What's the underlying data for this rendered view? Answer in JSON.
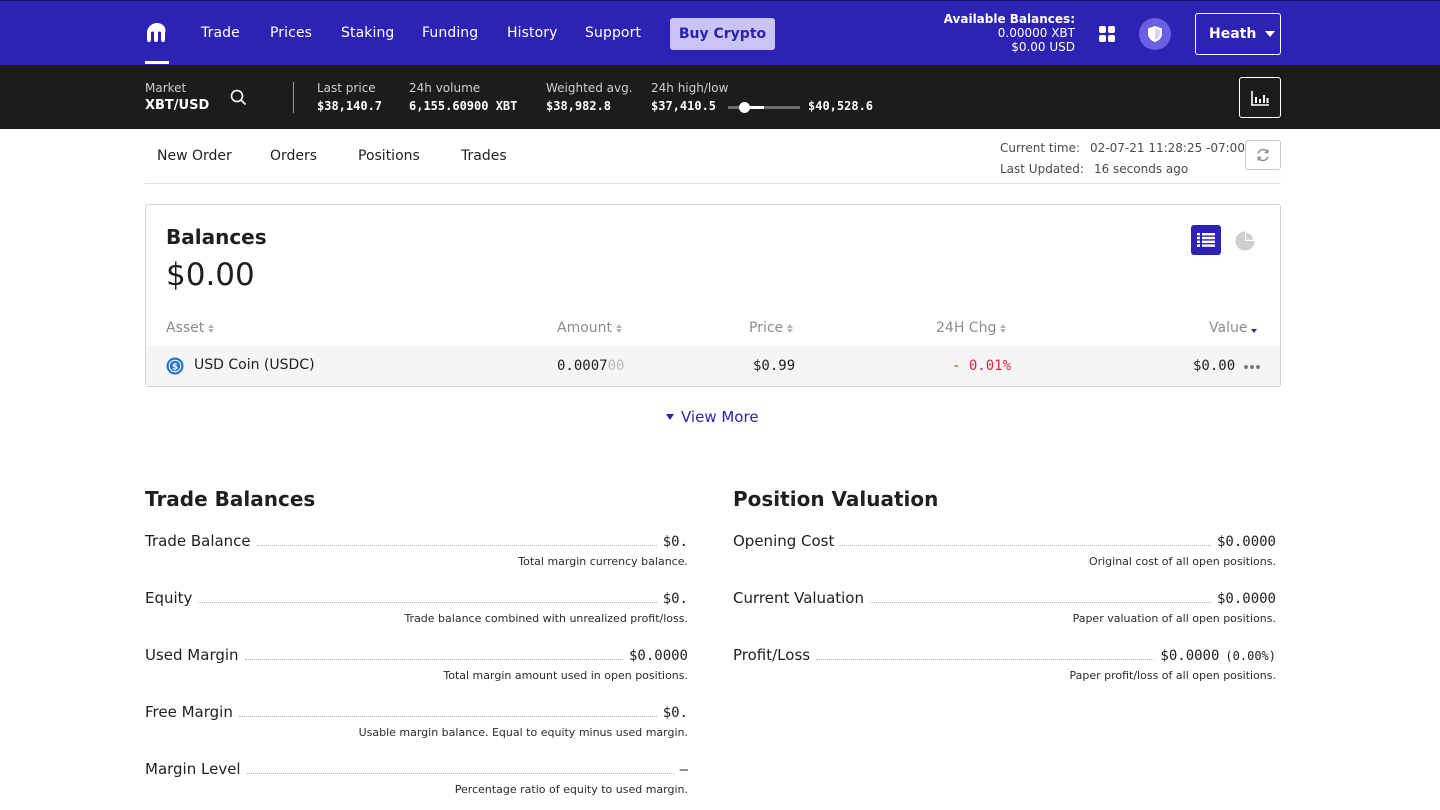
{
  "nav": {
    "items": [
      "Trade",
      "Prices",
      "Staking",
      "Funding",
      "History",
      "Support"
    ],
    "buy_label": "Buy Crypto",
    "balances_title": "Available Balances:",
    "balance_xbt": "0.00000 XBT",
    "balance_usd": "$0.00 USD",
    "user_name": "Heath"
  },
  "ticker": {
    "market_label": "Market",
    "pair": "XBT/USD",
    "last_price_label": "Last price",
    "last_price": "$38,140.7",
    "volume_label": "24h volume",
    "volume": "6,155.60900 XBT",
    "weighted_label": "Weighted avg.",
    "weighted": "$38,982.8",
    "highlow_label": "24h high/low",
    "low": "$37,410.5",
    "high": "$40,528.6"
  },
  "subnav": {
    "tabs": [
      "New Order",
      "Orders",
      "Positions",
      "Trades"
    ],
    "current_time_label": "Current time:",
    "current_time": "02-07-21 11:28:25 -07:00",
    "last_updated_label": "Last Updated:",
    "last_updated": "16 seconds ago"
  },
  "balances": {
    "title": "Balances",
    "total": "$0.00",
    "columns": [
      "Asset",
      "Amount",
      "Price",
      "24H Chg",
      "Value"
    ],
    "rows": [
      {
        "asset": "USD Coin (USDC)",
        "amount_main": "0.0007",
        "amount_faded": "00",
        "price": "$0.99",
        "change": "- 0.01%",
        "value": "$0.00"
      }
    ],
    "view_more": "View More"
  },
  "trade_balances": {
    "title": "Trade Balances",
    "items": [
      {
        "label": "Trade Balance",
        "value": "$0.",
        "desc": "Total margin currency balance."
      },
      {
        "label": "Equity",
        "value": "$0.",
        "desc": "Trade balance combined with unrealized profit/loss."
      },
      {
        "label": "Used Margin",
        "value": "$0.0000",
        "desc": "Total margin amount used in open positions."
      },
      {
        "label": "Free Margin",
        "value": "$0.",
        "desc": "Usable margin balance. Equal to equity minus used margin."
      },
      {
        "label": "Margin Level",
        "value": "—",
        "desc": "Percentage ratio of equity to used margin."
      }
    ]
  },
  "position_valuation": {
    "title": "Position Valuation",
    "items": [
      {
        "label": "Opening Cost",
        "value": "$0.0000",
        "desc": "Original cost of all open positions."
      },
      {
        "label": "Current Valuation",
        "value": "$0.0000",
        "desc": "Paper valuation of all open positions."
      },
      {
        "label": "Profit/Loss",
        "value": "$0.0000",
        "value_sub": "(0.00%)",
        "desc": "Paper profit/loss of all open positions."
      }
    ]
  },
  "colors": {
    "brand": "#2c23b4",
    "ticker_bg": "#1c1c1c",
    "negative": "#e0263b"
  }
}
